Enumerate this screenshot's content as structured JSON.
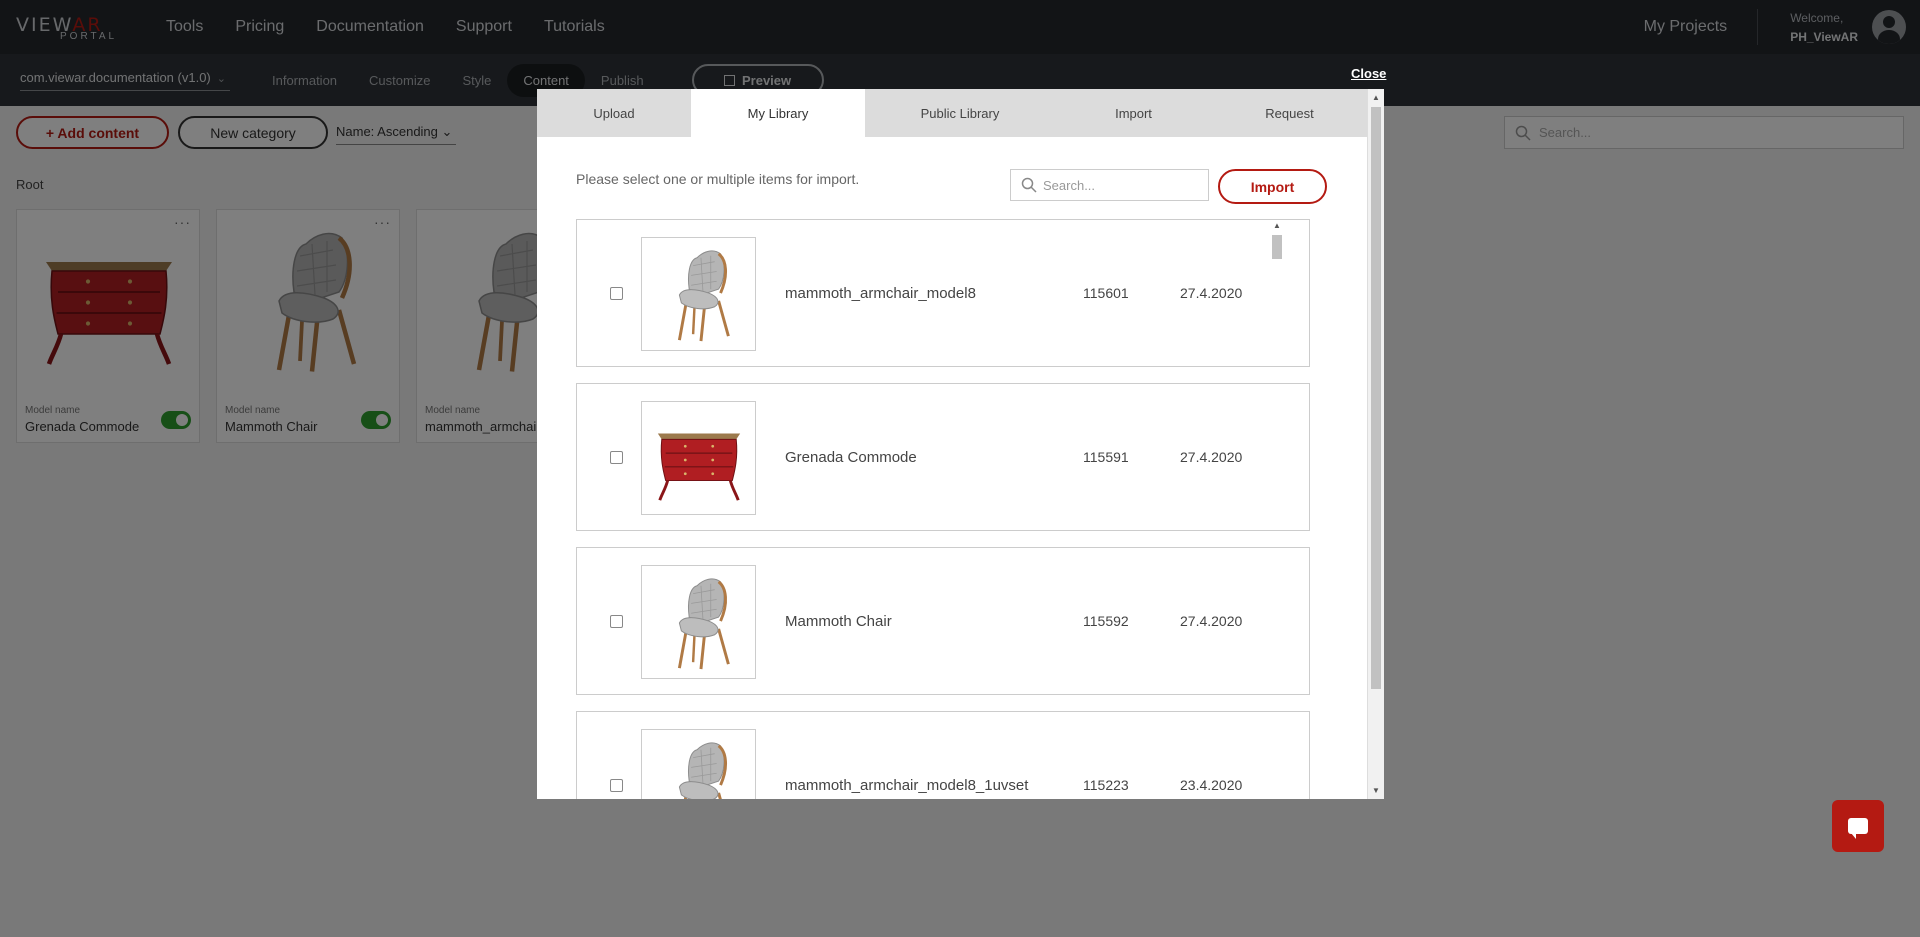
{
  "topnav": {
    "logo_main": "VIEW",
    "logo_accent": "AR",
    "logo_sub": "PORTAL",
    "links": [
      "Tools",
      "Pricing",
      "Documentation",
      "Support",
      "Tutorials"
    ],
    "my_projects": "My Projects",
    "welcome": "Welcome,",
    "username": "PH_ViewAR"
  },
  "subnav": {
    "project": "com.viewar.documentation (v1.0)",
    "tabs": [
      "Information",
      "Customize",
      "Style",
      "Content",
      "Publish"
    ],
    "active_tab": "Content",
    "preview": "Preview"
  },
  "toolbar": {
    "add_content": "+ Add content",
    "new_category": "New category",
    "sort": "Name: Ascending",
    "search_placeholder": "Search..."
  },
  "breadcrumb": "Root",
  "cards": [
    {
      "label": "Model name",
      "name": "Grenada Commode",
      "enabled": true
    },
    {
      "label": "Model name",
      "name": "Mammoth Chair",
      "enabled": true
    },
    {
      "label": "Model name",
      "name": "mammoth_armchair_"
    }
  ],
  "modal": {
    "close": "Close",
    "tabs": [
      "Upload",
      "My Library",
      "Public Library",
      "Import",
      "Request"
    ],
    "active_tab": "My Library",
    "prompt": "Please select one or multiple items for import.",
    "search_placeholder": "Search...",
    "import_button": "Import",
    "items": [
      {
        "name": "mammoth_armchair_model8",
        "id": "115601",
        "date": "27.4.2020",
        "thumb": "chair"
      },
      {
        "name": "Grenada Commode",
        "id": "115591",
        "date": "27.4.2020",
        "thumb": "commode"
      },
      {
        "name": "Mammoth Chair",
        "id": "115592",
        "date": "27.4.2020",
        "thumb": "chair"
      },
      {
        "name": "mammoth_armchair_model8_1uvset",
        "id": "115223",
        "date": "23.4.2020",
        "thumb": "chair"
      }
    ]
  },
  "colors": {
    "accent": "#b41a12",
    "toggle_on": "#2e9e2e",
    "topbar": "#24282d"
  }
}
